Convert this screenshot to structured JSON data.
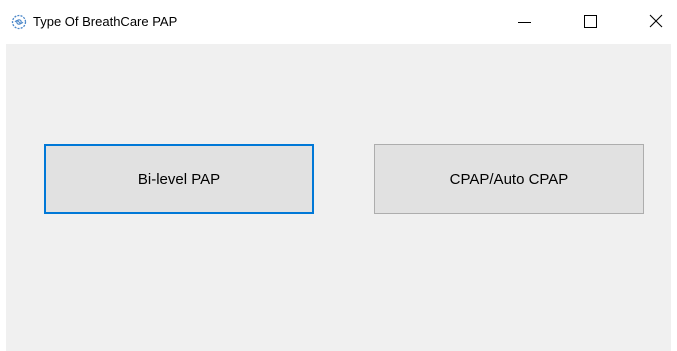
{
  "window": {
    "title": "Type Of BreathCare PAP",
    "app_icon": "breathcare-app-icon",
    "controls": {
      "minimize_icon": "minimize-icon",
      "maximize_icon": "maximize-icon",
      "close_icon": "close-icon"
    }
  },
  "main": {
    "buttons": [
      {
        "label": "Bi-level PAP",
        "focused": true
      },
      {
        "label": "CPAP/Auto CPAP",
        "focused": false
      }
    ]
  },
  "colors": {
    "client_background": "#f0f0f0",
    "button_face": "#e1e1e1",
    "button_border": "#adadad",
    "focus_accent": "#0078d7",
    "app_icon": "#4a86c8"
  }
}
